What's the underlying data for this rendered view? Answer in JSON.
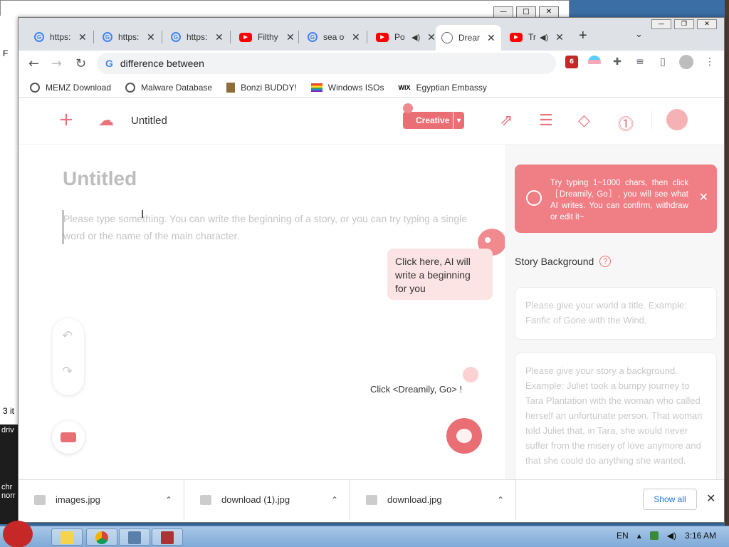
{
  "browser": {
    "tabs": [
      {
        "label": "https:",
        "icon": "google-icon"
      },
      {
        "label": "https:",
        "icon": "google-icon"
      },
      {
        "label": "https:",
        "icon": "google-icon"
      },
      {
        "label": "Filthy",
        "icon": "youtube-icon"
      },
      {
        "label": "sea of",
        "icon": "google-icon"
      },
      {
        "label": "Po",
        "icon": "youtube-icon"
      },
      {
        "label": "Drean",
        "icon": "globe-icon",
        "active": true
      },
      {
        "label": "Tr",
        "icon": "youtube-icon"
      }
    ],
    "close_glyph": "✕",
    "new_tab_glyph": "+",
    "tab_menu_glyph": "⌄",
    "address": "difference between",
    "google_glyph": "G",
    "ext_badge_count": "6",
    "bookmarks": [
      {
        "label": "MEMZ Download"
      },
      {
        "label": "Malware Database"
      },
      {
        "label": "Bonzi BUDDY!"
      },
      {
        "label": "Windows ISOs"
      },
      {
        "label": "Egyptian Embassy",
        "icon_text": "WIX"
      }
    ]
  },
  "app": {
    "doc_title": "Untitled",
    "mode_label": "Creative",
    "editor": {
      "title_placeholder": "Untitled",
      "body_placeholder": "Please type something. You can write the beginning of a story, or you can try typing a single word or the name of the main character.",
      "tip": "Click here, AI will write a beginning for you",
      "go_hint": "Click <Dreamily, Go> !"
    },
    "sidebar": {
      "banner": "Try typing 1~1000 chars, then click［Dreamily, Go］, you will see what AI writes. You can confirm, withdraw or edit it~",
      "story_background_label": "Story Background",
      "help_glyph": "?",
      "world_title_placeholder": "Please give your world a title. Example: Fanfic of Gone with the Wind.",
      "background_placeholder": "Please give your story a background. Example: Juliet took a bumpy journey to Tara Plantation with the woman who called herself an unfortunate person. That woman told Juliet that, in Tara, she would never suffer from the misery of love anymore and that she could do anything she wanted."
    },
    "accent_color": "#ea6f74"
  },
  "downloads": {
    "items": [
      {
        "name": "images.jpg"
      },
      {
        "name": "download (1).jpg"
      },
      {
        "name": "download.jpg"
      }
    ],
    "show_all": "Show all"
  },
  "taskbar": {
    "language": "EN",
    "time": "3:16 AM"
  },
  "desktop": {
    "left_texts": [
      "F",
      "3 it",
      "driv",
      "chr",
      "norr"
    ]
  }
}
